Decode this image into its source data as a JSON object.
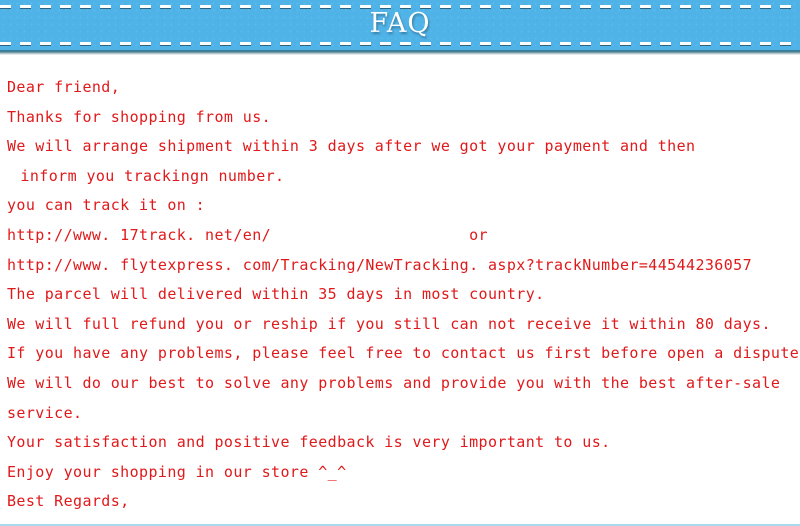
{
  "header": {
    "title": "FAQ",
    "banner_color": "#4fb3e8",
    "stitch_color": "#ffffff",
    "title_color": "#ffffff"
  },
  "theme": {
    "text_color": "#e0191b",
    "background_color": "#ffffff",
    "bottom_border_color": "#a9d9ef"
  },
  "body": {
    "lines": [
      {
        "id": "greeting",
        "text": "Dear friend,"
      },
      {
        "id": "thanks",
        "text": "Thanks for shopping from us."
      },
      {
        "id": "shipment-time",
        "text": "We will arrange shipment within 3 days after we got your payment and then"
      },
      {
        "id": "inform-tracking",
        "text": " inform you trackingn number.",
        "indent": true
      },
      {
        "id": "track-intro",
        "text": "you can track it on :"
      },
      {
        "id": "track-url-1",
        "text": "http://www. 17track. net/en/                     or"
      },
      {
        "id": "track-url-2",
        "text": "http://www. flytexpress. com/Tracking/NewTracking. aspx?trackNumber=44544236057"
      },
      {
        "id": "delivery-time",
        "text": "The parcel will delivered within 35 days in most country."
      },
      {
        "id": "refund-policy",
        "text": "We will full refund you or reship if you still can not receive it within 80 days."
      },
      {
        "id": "dispute-notice",
        "text": "If you have any problems, please feel free to contact us first before open a dispute."
      },
      {
        "id": "after-sale-1",
        "text": "We will do our best to solve any problems and provide you with the best after-sale"
      },
      {
        "id": "after-sale-2",
        "text": "service."
      },
      {
        "id": "feedback",
        "text": "Your satisfaction and positive feedback is very important to us."
      },
      {
        "id": "enjoy",
        "text": "Enjoy your shopping in our store ^_^"
      },
      {
        "id": "signoff",
        "text": "Best Regards,"
      }
    ]
  }
}
